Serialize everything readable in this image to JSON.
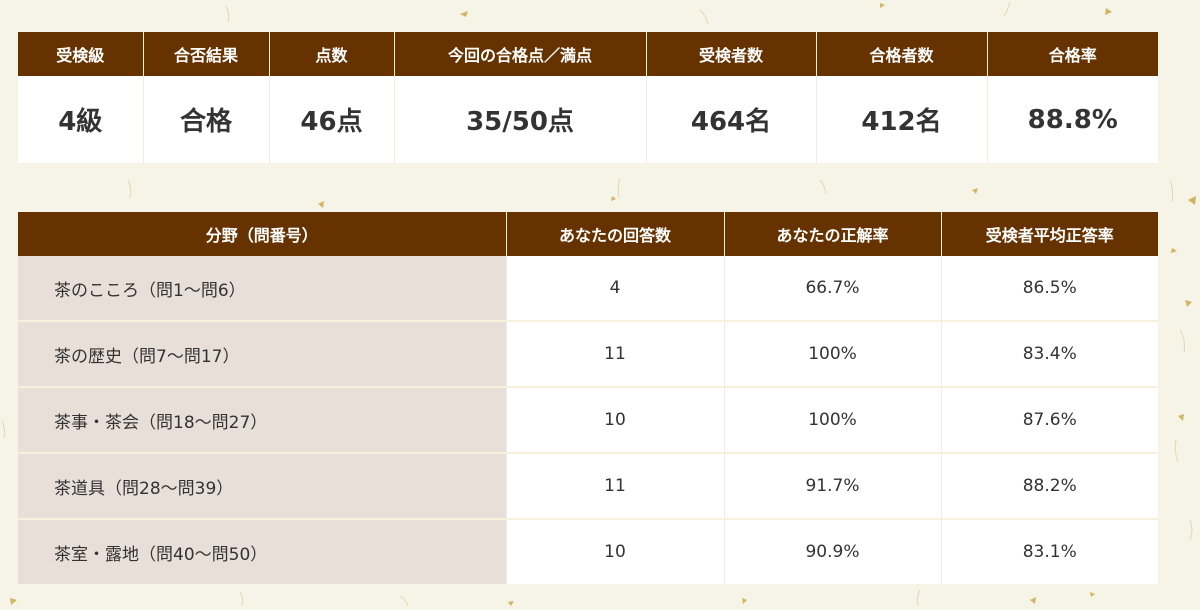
{
  "summary": {
    "headers": [
      "受検級",
      "合否結果",
      "点数",
      "今回の合格点／満点",
      "受検者数",
      "合格者数",
      "合格率"
    ],
    "values": [
      "4級",
      "合格",
      "46点",
      "35/50点",
      "464名",
      "412名",
      "88.8%"
    ]
  },
  "scores": {
    "headers": [
      "分野（問番号）",
      "あなたの回答数",
      "あなたの正解率",
      "受検者平均正答率"
    ],
    "rows": [
      [
        "茶のこころ（問1〜問6）",
        "4",
        "66.7%",
        "86.5%"
      ],
      [
        "茶の歴史（問7〜問17）",
        "11",
        "100%",
        "83.4%"
      ],
      [
        "茶事・茶会（問18〜問27）",
        "10",
        "100%",
        "87.6%"
      ],
      [
        "茶道具（問28〜問39）",
        "11",
        "91.7%",
        "88.2%"
      ],
      [
        "茶室・露地（問40〜問50）",
        "10",
        "90.9%",
        "83.1%"
      ]
    ]
  },
  "colors": {
    "header_bg": "#663300",
    "field_cell_bg": "#e8dfd8",
    "page_bg": "#f6f4e6",
    "flake": "#c9a94a"
  }
}
